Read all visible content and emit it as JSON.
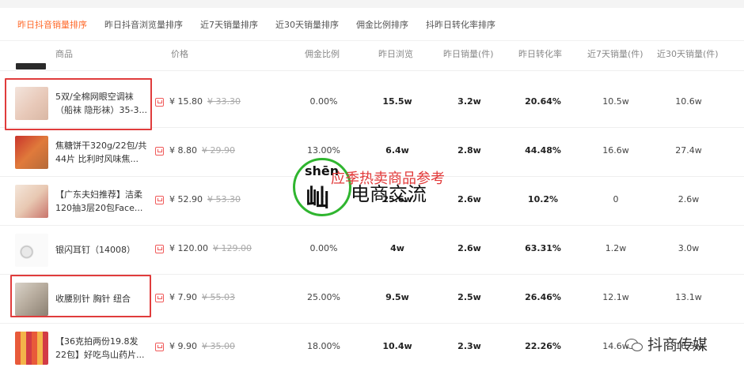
{
  "tabs": [
    {
      "label": "昨日抖音销量排序"
    },
    {
      "label": "昨日抖音浏览量排序"
    },
    {
      "label": "近7天销量排序"
    },
    {
      "label": "近30天销量排序"
    },
    {
      "label": "佣金比例排序"
    },
    {
      "label": "抖昨日转化率排序"
    }
  ],
  "columns": [
    "商品",
    "价格",
    "佣金比例",
    "昨日浏览",
    "昨日销量(件)",
    "昨日转化率",
    "近7天销量(件)",
    "近30天销量(件)"
  ],
  "rows": [
    {
      "name": "5双/全棉网眼空调袜（船袜 隐形袜）35-3...",
      "price": "¥ 15.80",
      "orig": "¥ 33.30",
      "commission": "0.00%",
      "views": "15.5w",
      "sales": "3.2w",
      "conversion": "20.64%",
      "sales7": "10.5w",
      "sales30": "10.6w"
    },
    {
      "name": "焦糖饼干320g/22包/共44片 比利时风味焦...",
      "price": "¥ 8.80",
      "orig": "¥ 29.90",
      "commission": "13.00%",
      "views": "6.4w",
      "sales": "2.8w",
      "conversion": "44.48%",
      "sales7": "16.6w",
      "sales30": "27.4w"
    },
    {
      "name": "【广东夫妇推荐】洁柔120抽3层20包Face...",
      "price": "¥ 52.90",
      "orig": "¥ 53.30",
      "commission": "0",
      "views": "25.6w",
      "sales": "2.6w",
      "conversion": "10.2%",
      "sales7": "0",
      "sales30": "2.6w"
    },
    {
      "name": "银闪耳钉（14008）",
      "price": "¥ 120.00",
      "orig": "¥ 129.00",
      "commission": "0.00%",
      "views": "4w",
      "sales": "2.6w",
      "conversion": "63.31%",
      "sales7": "1.2w",
      "sales30": "3.0w"
    },
    {
      "name": "收腰别针 胸针 纽合",
      "price": "¥ 7.90",
      "orig": "¥ 55.03",
      "commission": "25.00%",
      "views": "9.5w",
      "sales": "2.5w",
      "conversion": "26.46%",
      "sales7": "12.1w",
      "sales30": "13.1w"
    },
    {
      "name": "【36克拍两份19.8发22包】好吃鸟山药片...",
      "price": "¥ 9.90",
      "orig": "¥ 35.00",
      "commission": "18.00%",
      "views": "10.4w",
      "sales": "2.3w",
      "conversion": "22.26%",
      "sales7": "14.6w",
      "sales30": "16.5w"
    }
  ],
  "watermark": {
    "pinyin": "shēn",
    "glyph": "屾",
    "text": "电商交流",
    "red_text": "应季热卖商品参考"
  },
  "footer": {
    "brand": "抖商传媒"
  },
  "colors": {
    "accent": "#ff6a2b",
    "highlight": "#e03c3c",
    "watermark_ring": "#2fb52f"
  }
}
